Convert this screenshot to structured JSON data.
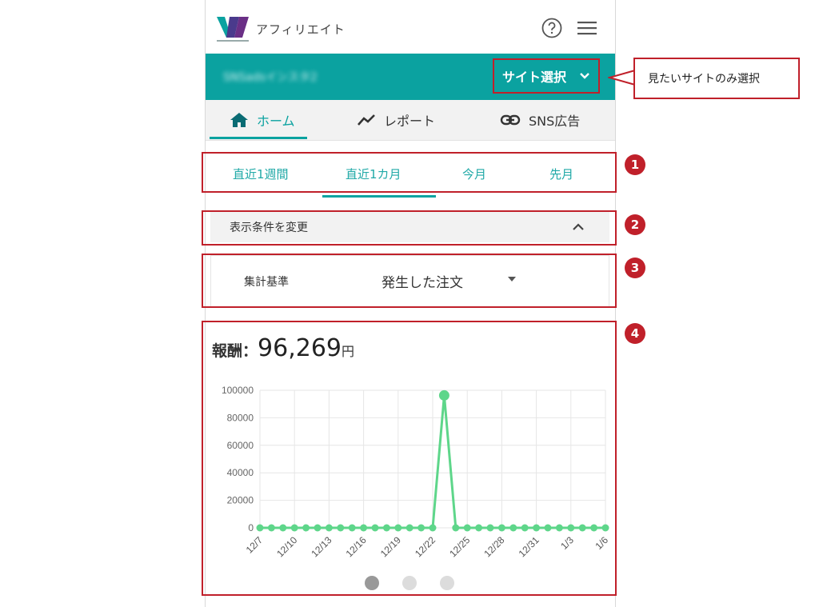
{
  "app": {
    "name": "アフィリエイト"
  },
  "sitebar": {
    "site_name": "SNSadsインスタ2",
    "select_label": "サイト選択"
  },
  "nav": {
    "tabs": [
      {
        "label": "ホーム"
      },
      {
        "label": "レポート"
      },
      {
        "label": "SNS広告"
      }
    ]
  },
  "periods": [
    {
      "label": "直近1週間"
    },
    {
      "label": "直近1カ月"
    },
    {
      "label": "今月"
    },
    {
      "label": "先月"
    }
  ],
  "conditions": {
    "toggle_label": "表示条件を変更"
  },
  "criteria": {
    "label": "集計基準",
    "value": "発生した注文"
  },
  "reward": {
    "label": "報酬：",
    "value": "96,269",
    "unit": "円"
  },
  "annotations": {
    "callout": "見たいサイトのみ選択",
    "badges": [
      "1",
      "2",
      "3",
      "4"
    ]
  },
  "colors": {
    "accent": "#0ba2a0",
    "annotation": "#c0202a",
    "line": "#5ed68a"
  },
  "carousel": {
    "count": 3,
    "active_index": 0
  },
  "chart_data": {
    "type": "line",
    "x": [
      "12/7",
      "12/8",
      "12/9",
      "12/10",
      "12/11",
      "12/12",
      "12/13",
      "12/14",
      "12/15",
      "12/16",
      "12/17",
      "12/18",
      "12/19",
      "12/20",
      "12/21",
      "12/22",
      "12/23",
      "12/24",
      "12/25",
      "12/26",
      "12/27",
      "12/28",
      "12/29",
      "12/30",
      "12/31",
      "1/1",
      "1/2",
      "1/3",
      "1/4",
      "1/5",
      "1/6"
    ],
    "x_tick_labels": [
      "12/7",
      "12/10",
      "12/13",
      "12/16",
      "12/19",
      "12/22",
      "12/25",
      "12/28",
      "12/31",
      "1/3",
      "1/6"
    ],
    "series": [
      {
        "values": [
          0,
          0,
          0,
          0,
          0,
          0,
          0,
          0,
          0,
          0,
          0,
          0,
          0,
          0,
          0,
          0,
          96269,
          0,
          0,
          0,
          0,
          0,
          0,
          0,
          0,
          0,
          0,
          0,
          0,
          0,
          0
        ]
      }
    ],
    "ylim": [
      0,
      100000
    ],
    "y_ticks": [
      0,
      20000,
      40000,
      60000,
      80000,
      100000
    ],
    "grid": true
  }
}
